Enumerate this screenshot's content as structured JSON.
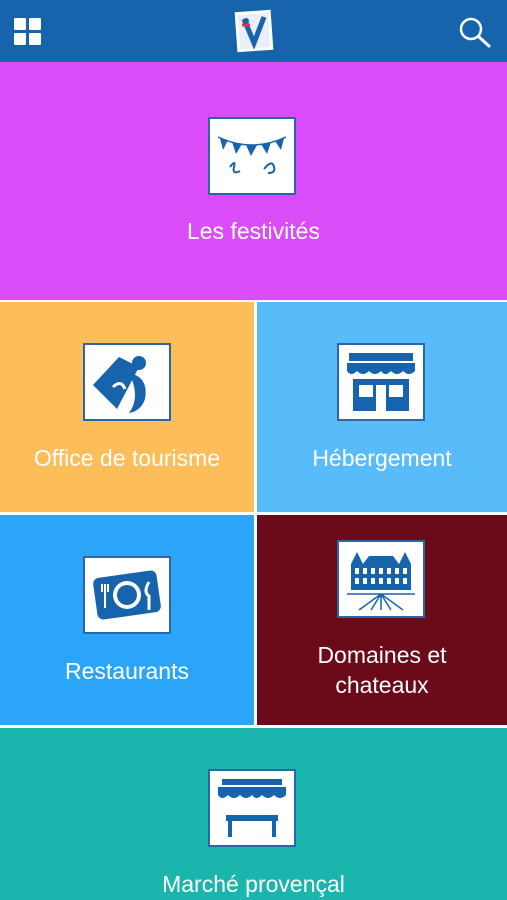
{
  "header": {
    "menu_icon": "grid-icon",
    "logo_icon": "city-logo-icon",
    "search_icon": "search-icon"
  },
  "tiles": [
    {
      "label": "Les festivités",
      "icon": "bunting-icon",
      "color": "#db4cf9"
    },
    {
      "label": "Office de tourisme",
      "icon": "tourism-office-icon",
      "color": "#fdbd58"
    },
    {
      "label": "Hébergement",
      "icon": "storefront-icon",
      "color": "#58bcfb"
    },
    {
      "label": "Restaurants",
      "icon": "plate-cutlery-icon",
      "color": "#2ba5f9"
    },
    {
      "label_line1": "Domaines et",
      "label_line2": "chateaux",
      "icon": "chateau-icon",
      "color": "#6b0b19"
    },
    {
      "label": "Marché provençal",
      "icon": "market-stall-icon",
      "color": "#1ab6ae"
    }
  ],
  "colors": {
    "header": "#1764ad",
    "icon_border": "#2a66ac"
  }
}
